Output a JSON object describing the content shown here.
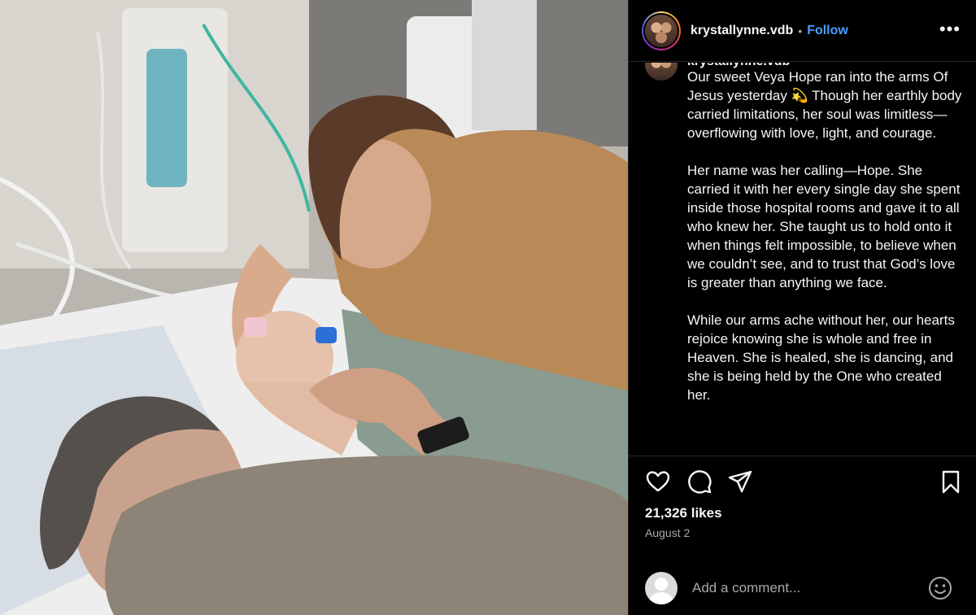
{
  "post": {
    "image_alt": "",
    "header": {
      "username": "krystallynne.vdb",
      "separator": "•",
      "follow_label": "Follow",
      "more_icon": "more-horizontal-icon"
    },
    "caption": {
      "username": "krystallynne.vdb",
      "paragraphs": [
        "Our sweet Veya Hope ran into the arms Of Jesus yesterday 💫 Though her earthly body carried limitations, her soul was limitless—overflowing with love, light, and courage.",
        "Her name was her calling—Hope. She carried it with her every single day she spent inside those hospital rooms and gave it to all who knew her. She taught us to hold onto it when things felt impossible, to believe when we couldn’t see, and to trust that God’s love is greater than anything we face.",
        "While our arms ache without her, our hearts rejoice knowing she is whole and free in Heaven. She is healed, she is dancing, and she is being held by the One who created her."
      ]
    },
    "actions": {
      "like_icon": "heart-icon",
      "comment_icon": "comment-icon",
      "share_icon": "paper-plane-icon",
      "save_icon": "bookmark-icon"
    },
    "likes_text": "21,326 likes",
    "date_text": "August 2",
    "comment": {
      "placeholder": "Add a comment...",
      "emoji_icon": "smiley-icon"
    }
  },
  "colors": {
    "background": "#000000",
    "text": "#f5f5f5",
    "secondary_text": "#a8a8a8",
    "follow_blue": "#4a9eff",
    "divider": "#262626"
  }
}
